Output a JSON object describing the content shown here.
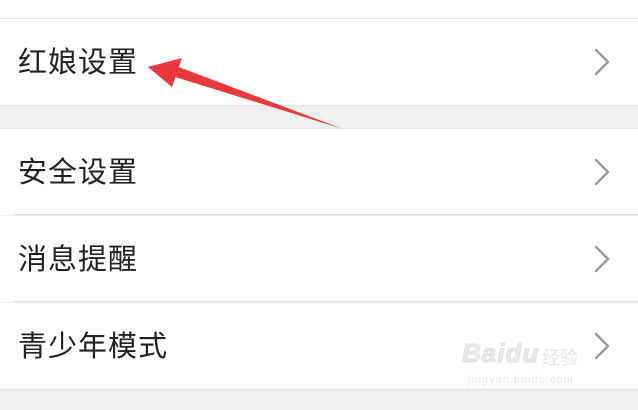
{
  "settings": {
    "group1": [
      {
        "label": "红娘设置",
        "icon": "chevron-right-icon"
      }
    ],
    "group2": [
      {
        "label": "安全设置",
        "icon": "chevron-right-icon"
      },
      {
        "label": "消息提醒",
        "icon": "chevron-right-icon"
      },
      {
        "label": "青少年模式",
        "icon": "chevron-right-icon"
      }
    ]
  },
  "annotation": {
    "color": "#e8383d",
    "icon": "arrow-annotation-icon"
  },
  "watermark": {
    "brand": "Baidu",
    "label": "经验",
    "url": "jingyan.baidu.com"
  },
  "colors": {
    "background": "#f0f0f0",
    "row": "#ffffff",
    "text": "#222222",
    "chevron": "#9a9a9a",
    "divider": "#e2e2e2"
  }
}
